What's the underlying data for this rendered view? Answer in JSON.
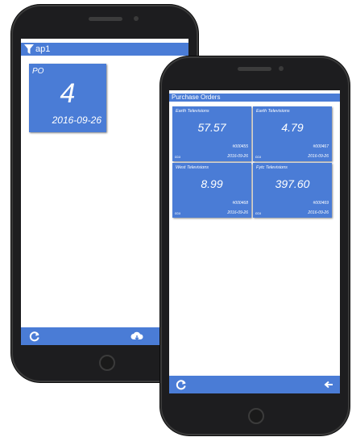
{
  "back_phone": {
    "filter_label": "ap1",
    "tile": {
      "label": "PO",
      "value": "4",
      "date": "2016-09-26"
    },
    "icons": {
      "filter": "filter-icon",
      "refresh": "refresh-icon",
      "sync": "cloud-sync-icon"
    }
  },
  "front_phone": {
    "title": "Purchase Orders",
    "orders": [
      {
        "name": "Earth Televisions",
        "amount": "57.57",
        "order": "#000455",
        "code": "ccu",
        "date": "2016-09-26"
      },
      {
        "name": "Earth Televisions",
        "amount": "4.79",
        "order": "#000467",
        "code": "ccu",
        "date": "2016-09-26"
      },
      {
        "name": "West Televisions",
        "amount": "8.99",
        "order": "#000468",
        "code": "ccu",
        "date": "2016-09-26"
      },
      {
        "name": "Fytc Televisions",
        "amount": "397.60",
        "order": "#000469",
        "code": "ccu",
        "date": "2016-09-26"
      }
    ],
    "icons": {
      "refresh": "refresh-icon",
      "back": "back-arrow-icon"
    }
  },
  "colors": {
    "accent": "#4a7cd6",
    "device": "#1d1d1f",
    "screen": "#ffffff"
  }
}
